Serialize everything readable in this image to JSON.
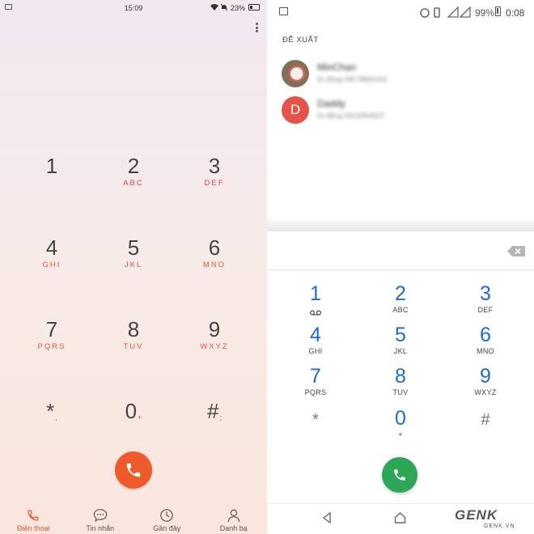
{
  "left_phone": {
    "status_bar": {
      "time": "15:09",
      "battery": "23%"
    },
    "keypad": [
      {
        "digit": "1",
        "letters": ""
      },
      {
        "digit": "2",
        "letters": "ABC"
      },
      {
        "digit": "3",
        "letters": "DEF"
      },
      {
        "digit": "4",
        "letters": "GHI"
      },
      {
        "digit": "5",
        "letters": "JKL"
      },
      {
        "digit": "6",
        "letters": "MNO"
      },
      {
        "digit": "7",
        "letters": "PQRS"
      },
      {
        "digit": "8",
        "letters": "TUV"
      },
      {
        "digit": "9",
        "letters": "WXYZ"
      },
      {
        "digit": "*",
        "letters": ","
      },
      {
        "digit": "0",
        "letters": "+"
      },
      {
        "digit": "#",
        "letters": ";"
      }
    ],
    "tabs": [
      {
        "label": "Điện thoại",
        "icon": "phone-icon",
        "active": true
      },
      {
        "label": "Tin nhắn",
        "icon": "message-icon",
        "active": false
      },
      {
        "label": "Gần đây",
        "icon": "clock-icon",
        "active": false
      },
      {
        "label": "Danh bạ",
        "icon": "person-icon",
        "active": false
      }
    ],
    "accent_color": "#ef5a2a"
  },
  "right_phone": {
    "status_bar": {
      "time": "0:08",
      "battery": "99%"
    },
    "suggestions_header": "ĐỀ XUẤT",
    "contacts": [
      {
        "name": "MinChan",
        "detail": "Di động 090 8865343",
        "avatar_letter": ""
      },
      {
        "name": "Daddy",
        "detail": "Di động 0913064507",
        "avatar_letter": "D"
      }
    ],
    "keypad": [
      {
        "digit": "1",
        "letters": ""
      },
      {
        "digit": "2",
        "letters": "ABC"
      },
      {
        "digit": "3",
        "letters": "DEF"
      },
      {
        "digit": "4",
        "letters": "GHI"
      },
      {
        "digit": "5",
        "letters": "JKL"
      },
      {
        "digit": "6",
        "letters": "MNO"
      },
      {
        "digit": "7",
        "letters": "PQRS"
      },
      {
        "digit": "8",
        "letters": "TUV"
      },
      {
        "digit": "9",
        "letters": "WXYZ"
      },
      {
        "digit": "*",
        "letters": ""
      },
      {
        "digit": "0",
        "letters": "+"
      },
      {
        "digit": "#",
        "letters": ""
      }
    ],
    "accent_color": "#1e6bd6",
    "call_color": "#2ea658"
  },
  "watermark": {
    "brand": "GENK",
    "site": "GENK.VN"
  }
}
